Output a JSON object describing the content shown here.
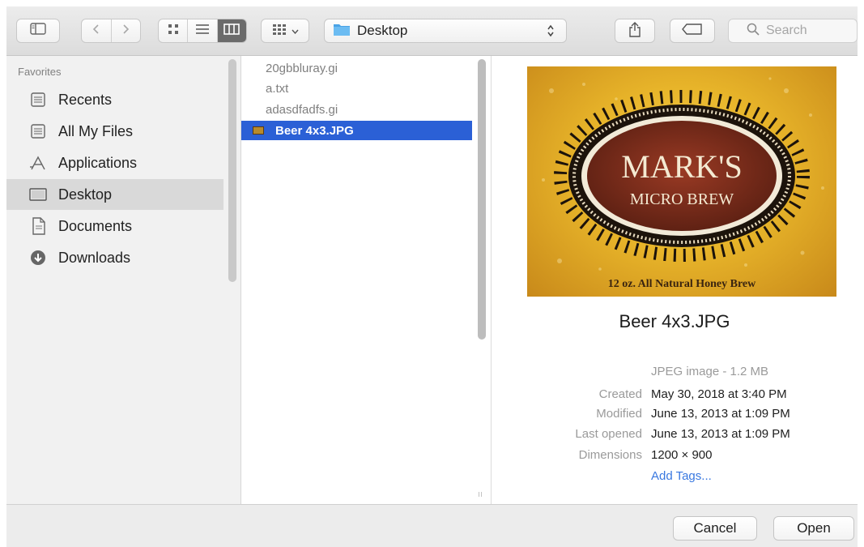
{
  "toolbar": {
    "path": "Desktop",
    "search_placeholder": "Search"
  },
  "sidebar": {
    "section_title": "Favorites",
    "items": [
      {
        "label": "Recents",
        "icon": "recents-icon"
      },
      {
        "label": "All My Files",
        "icon": "all-files-icon"
      },
      {
        "label": "Applications",
        "icon": "applications-icon"
      },
      {
        "label": "Desktop",
        "icon": "desktop-icon",
        "selected": true
      },
      {
        "label": "Documents",
        "icon": "documents-icon"
      },
      {
        "label": "Downloads",
        "icon": "downloads-icon"
      }
    ]
  },
  "files": [
    {
      "name": "20gbbluray.gi"
    },
    {
      "name": "a.txt"
    },
    {
      "name": "adasdfadfs.gi"
    },
    {
      "name": "Beer 4x3.JPG",
      "selected": true
    }
  ],
  "preview": {
    "image": {
      "line1": "MARK'S",
      "line2": "MICRO BREW",
      "caption": "12 oz. All Natural Honey Brew"
    },
    "name": "Beer 4x3.JPG",
    "kind": "JPEG image - 1.2 MB",
    "meta": [
      {
        "key": "Created",
        "value": "May 30, 2018 at 3:40 PM"
      },
      {
        "key": "Modified",
        "value": "June 13, 2013 at 1:09 PM"
      },
      {
        "key": "Last opened",
        "value": "June 13, 2013 at 1:09 PM"
      },
      {
        "key": "Dimensions",
        "value": "1200 × 900"
      }
    ],
    "add_tags": "Add Tags..."
  },
  "buttons": {
    "cancel": "Cancel",
    "open": "Open"
  },
  "colors": {
    "selection": "#2b60d6",
    "link": "#3978e0"
  }
}
